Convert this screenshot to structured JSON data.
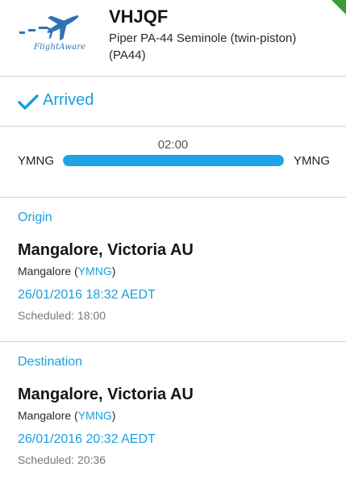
{
  "header": {
    "logo_text": "FlightAware",
    "tail_number": "VHJQF",
    "aircraft_type": "Piper PA-44 Seminole (twin-piston) (PA44)",
    "corner_color": "#3b9b3b"
  },
  "status": {
    "icon": "checkmark-icon",
    "label": "Arrived",
    "color": "#1a9fe0"
  },
  "progress": {
    "duration": "02:00",
    "origin_code": "YMNG",
    "destination_code": "YMNG",
    "fraction": 1.0
  },
  "origin": {
    "section_title": "Origin",
    "city": "Mangalore, Victoria AU",
    "airport_name": "Mangalore (",
    "airport_code": "YMNG",
    "airport_close": ")",
    "time": "26/01/2016 18:32 AEDT",
    "scheduled": "Scheduled: 18:00"
  },
  "destination": {
    "section_title": "Destination",
    "city": "Mangalore, Victoria AU",
    "airport_name": "Mangalore (",
    "airport_code": "YMNG",
    "airport_close": ")",
    "time": "26/01/2016 20:32 AEDT",
    "scheduled": "Scheduled: 20:36"
  }
}
